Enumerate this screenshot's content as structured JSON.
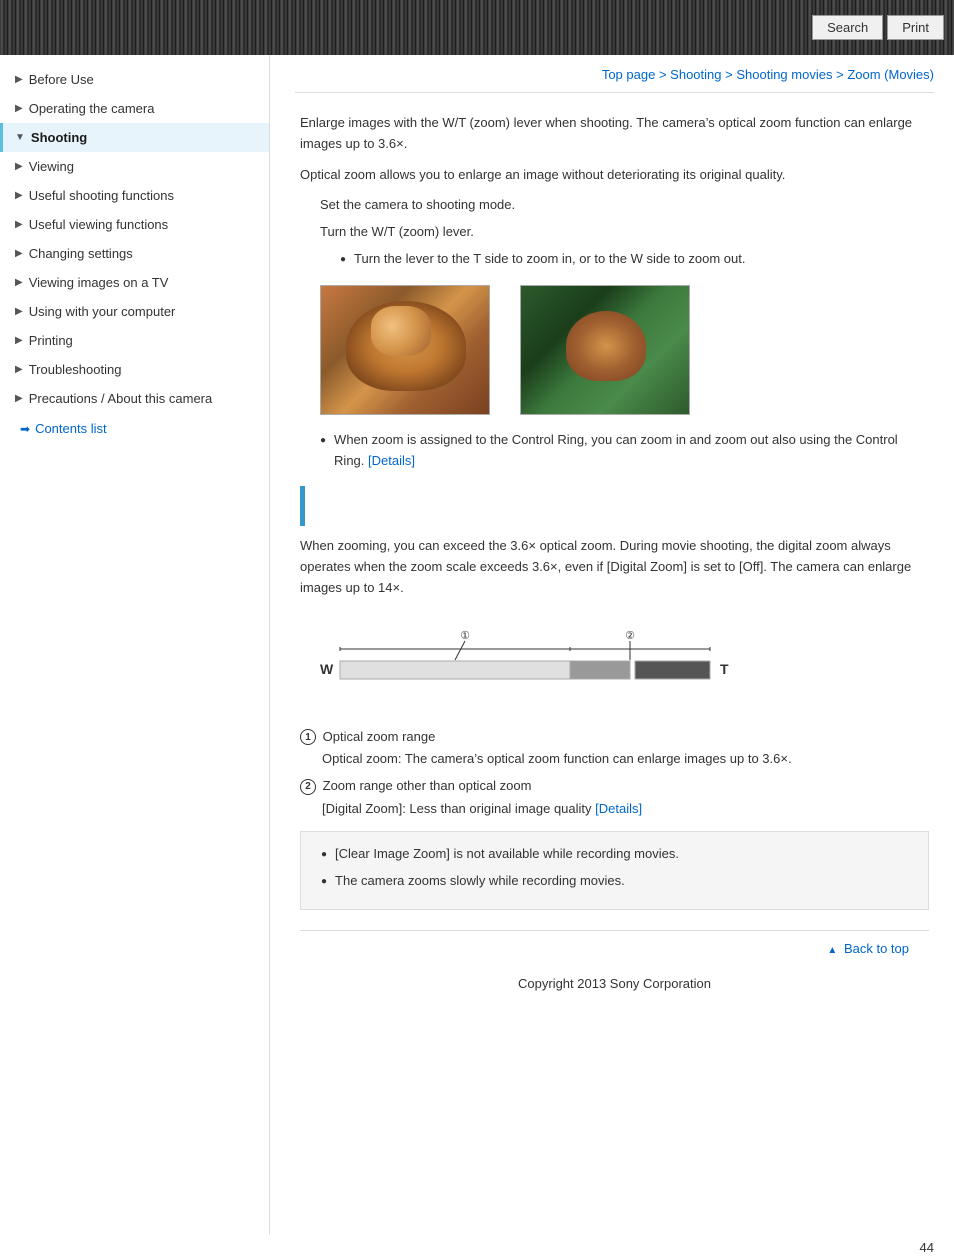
{
  "header": {
    "search_label": "Search",
    "print_label": "Print"
  },
  "breadcrumb": {
    "top_page": "Top page",
    "separator1": " > ",
    "shooting": "Shooting",
    "separator2": " > ",
    "shooting_movies": "Shooting movies",
    "separator3": " > ",
    "zoom_movies": "Zoom (Movies)"
  },
  "sidebar": {
    "items": [
      {
        "label": "Before Use",
        "active": false
      },
      {
        "label": "Operating the camera",
        "active": false
      },
      {
        "label": "Shooting",
        "active": true
      },
      {
        "label": "Viewing",
        "active": false
      },
      {
        "label": "Useful shooting functions",
        "active": false
      },
      {
        "label": "Useful viewing functions",
        "active": false
      },
      {
        "label": "Changing settings",
        "active": false
      },
      {
        "label": "Viewing images on a TV",
        "active": false
      },
      {
        "label": "Using with your computer",
        "active": false
      },
      {
        "label": "Printing",
        "active": false
      },
      {
        "label": "Troubleshooting",
        "active": false
      },
      {
        "label": "Precautions / About this camera",
        "active": false
      }
    ],
    "contents_list": "Contents list"
  },
  "content": {
    "intro_p1": "Enlarge images with the W/T (zoom) lever when shooting. The camera’s optical zoom function can enlarge images up to 3.6×.",
    "intro_p2": "Optical zoom allows you to enlarge an image without deteriorating its original quality.",
    "step1": "Set the camera to shooting mode.",
    "step2": "Turn the W/T (zoom) lever.",
    "bullet1": "Turn the lever to the T side to zoom in, or to the W side to zoom out.",
    "control_ring_note": "When zoom is assigned to the Control Ring, you can zoom in and zoom out also using the Control Ring.",
    "details1": "[Details]",
    "digital_zoom_p1": "When zooming, you can exceed the 3.6× optical zoom. During movie shooting, the digital zoom always operates when the zoom scale exceeds 3.6×, even if [Digital Zoom] is set to [Off]. The camera can enlarge images up to 14×.",
    "zoom_label1": "Optical zoom range",
    "zoom_desc1": "Optical zoom: The camera’s optical zoom function can enlarge images up to 3.6×.",
    "zoom_label2": "Zoom range other than optical zoom",
    "zoom_desc2": "[Digital Zoom]: Less than original image quality",
    "details2": "[Details]",
    "note1": "[Clear Image Zoom] is not available while recording movies.",
    "note2": "The camera zooms slowly while recording movies."
  },
  "footer": {
    "back_to_top": "Back to top",
    "copyright": "Copyright 2013 Sony Corporation",
    "page_number": "44"
  }
}
